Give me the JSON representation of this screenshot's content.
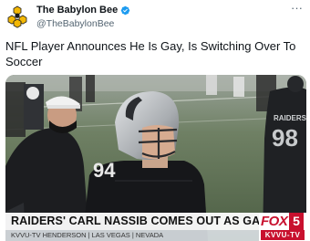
{
  "account": {
    "display_name": "The Babylon Bee",
    "handle": "@TheBabylonBee",
    "verified": true,
    "avatar_icon": "bee-logo-icon"
  },
  "more_label": "···",
  "tweet": {
    "text": "NFL Player Announces He Is Gay, Is Switching Over To Soccer"
  },
  "media": {
    "jersey_number": "94",
    "helmet_text": "RAIDERS",
    "chyron": {
      "headline": "RAIDERS' CARL NASSIB COMES OUT AS GAY",
      "location": "KVVU-TV HENDERSON | LAS VEGAS | NEVADA"
    },
    "station_logo": {
      "brand": "FOX",
      "channel": "5",
      "call_sign": "KVVU-TV"
    }
  },
  "colors": {
    "verified_blue": "#1d9bf0",
    "fox_red": "#c8102e",
    "text_primary": "#0f1419",
    "text_secondary": "#536471"
  }
}
